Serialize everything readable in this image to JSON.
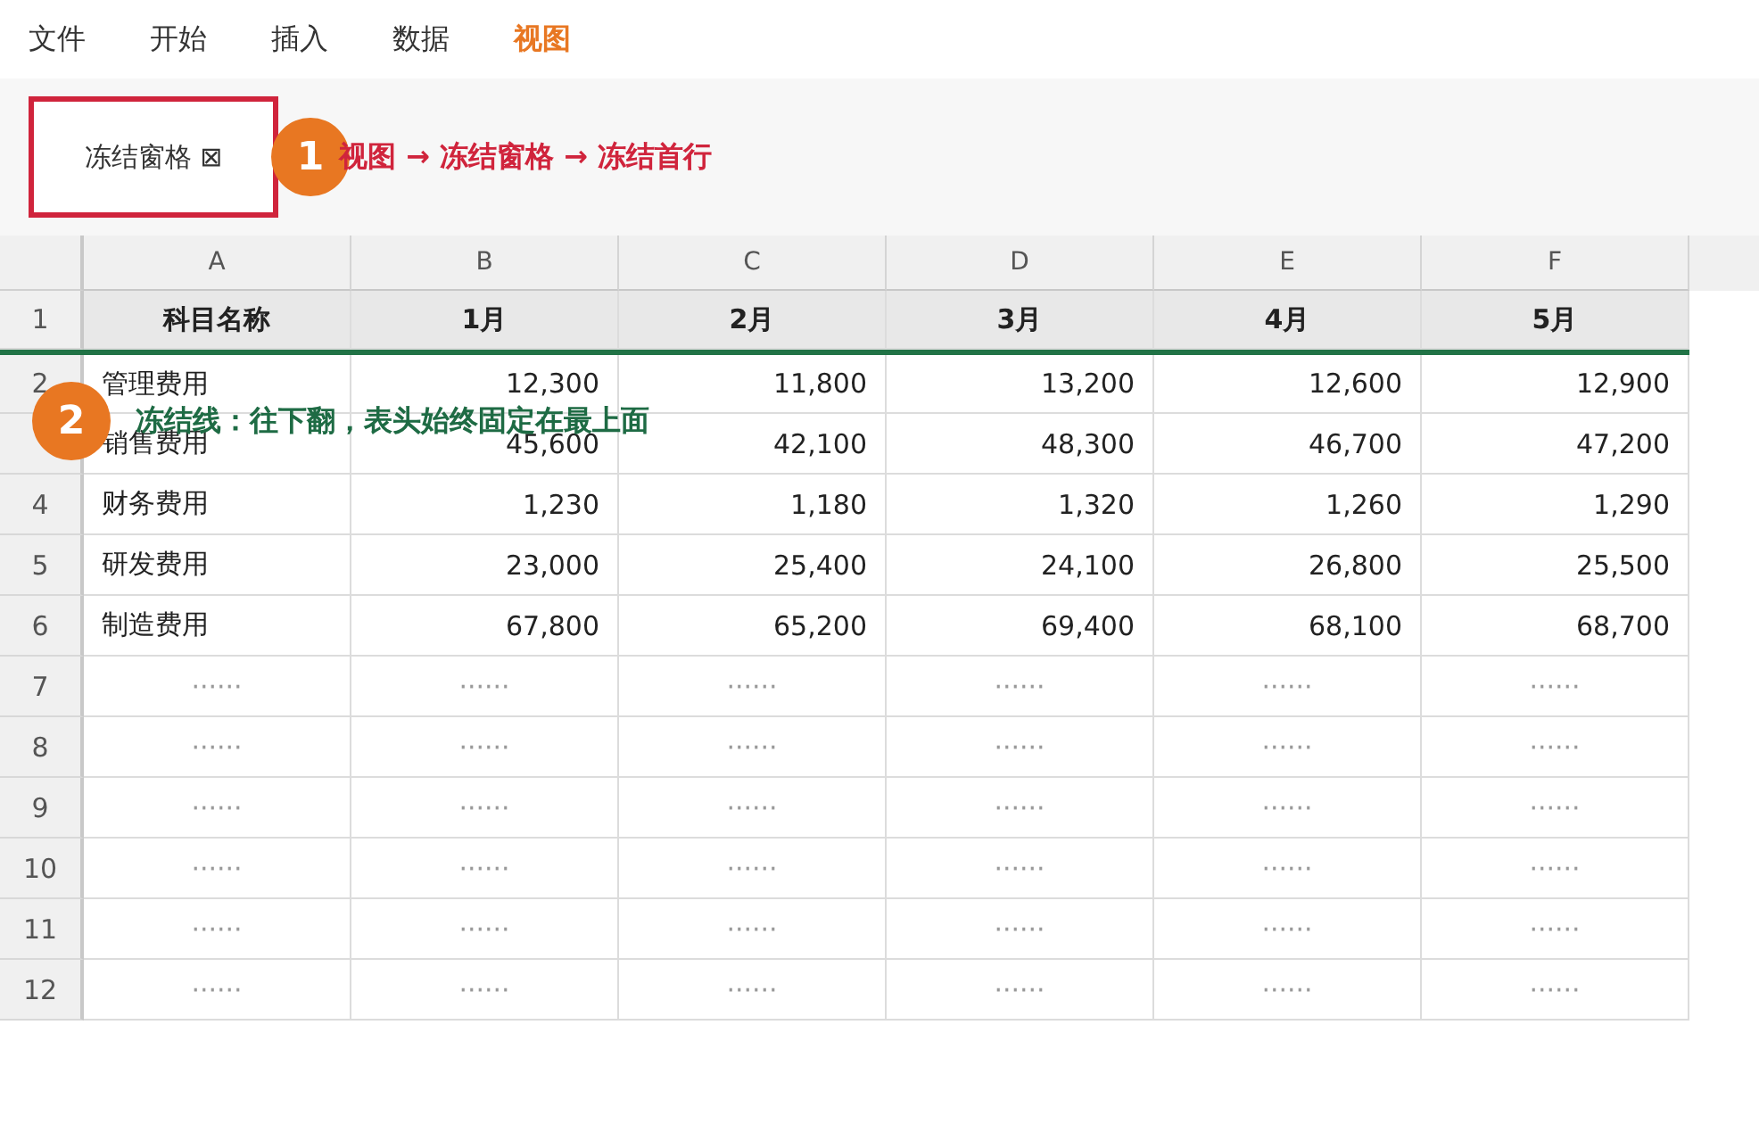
{
  "menu": [
    {
      "label": "文件",
      "selected": false
    },
    {
      "label": "开始",
      "selected": false
    },
    {
      "label": "插入",
      "selected": false
    },
    {
      "label": "数据",
      "selected": false
    },
    {
      "label": "视图",
      "selected": true
    }
  ],
  "ribbon": {
    "button": "冻结窗格 ⊠",
    "callout": {
      "number": "1",
      "text": "视图 → 冻结窗格 → 冻结首行"
    }
  },
  "sheet": {
    "columns": [
      "A",
      "B",
      "C",
      "D",
      "E",
      "F"
    ],
    "header_row": {
      "number": "1",
      "cells": [
        "科目名称",
        "1月",
        "2月",
        "3月",
        "4月",
        "5月"
      ]
    },
    "callout": {
      "number": "2",
      "text": "冻结线：往下翻，表头始终固定在最上面"
    },
    "rows": [
      {
        "number": "2",
        "cells": [
          "管理费用",
          "12,300",
          "11,800",
          "13,200",
          "12,600",
          "12,900"
        ]
      },
      {
        "cells": [
          "销售费用",
          "45,600",
          "42,100",
          "48,300",
          "46,700",
          "47,200"
        ]
      },
      {
        "number": "4",
        "cells": [
          "财务费用",
          "1,230",
          "1,180",
          "1,320",
          "1,260",
          "1,290"
        ]
      },
      {
        "number": "5",
        "cells": [
          "研发费用",
          "23,000",
          "25,400",
          "24,100",
          "26,800",
          "25,500"
        ]
      },
      {
        "number": "6",
        "cells": [
          "制造费用",
          "67,800",
          "65,200",
          "69,400",
          "68,100",
          "68,700"
        ]
      },
      {
        "number": "7",
        "cells": [
          "······",
          "······",
          "······",
          "······",
          "······",
          "······"
        ]
      },
      {
        "number": "8",
        "cells": [
          "······",
          "······",
          "······",
          "······",
          "······",
          "······"
        ]
      },
      {
        "number": "9",
        "cells": [
          "······",
          "······",
          "······",
          "······",
          "······",
          "······"
        ]
      },
      {
        "number": "10",
        "cells": [
          "······",
          "······",
          "······",
          "······",
          "······",
          "······"
        ]
      },
      {
        "number": "11",
        "cells": [
          "······",
          "······",
          "······",
          "······",
          "······",
          "······"
        ]
      },
      {
        "number": "12",
        "cells": [
          "······",
          "······",
          "······",
          "······",
          "······",
          "······"
        ]
      }
    ]
  }
}
